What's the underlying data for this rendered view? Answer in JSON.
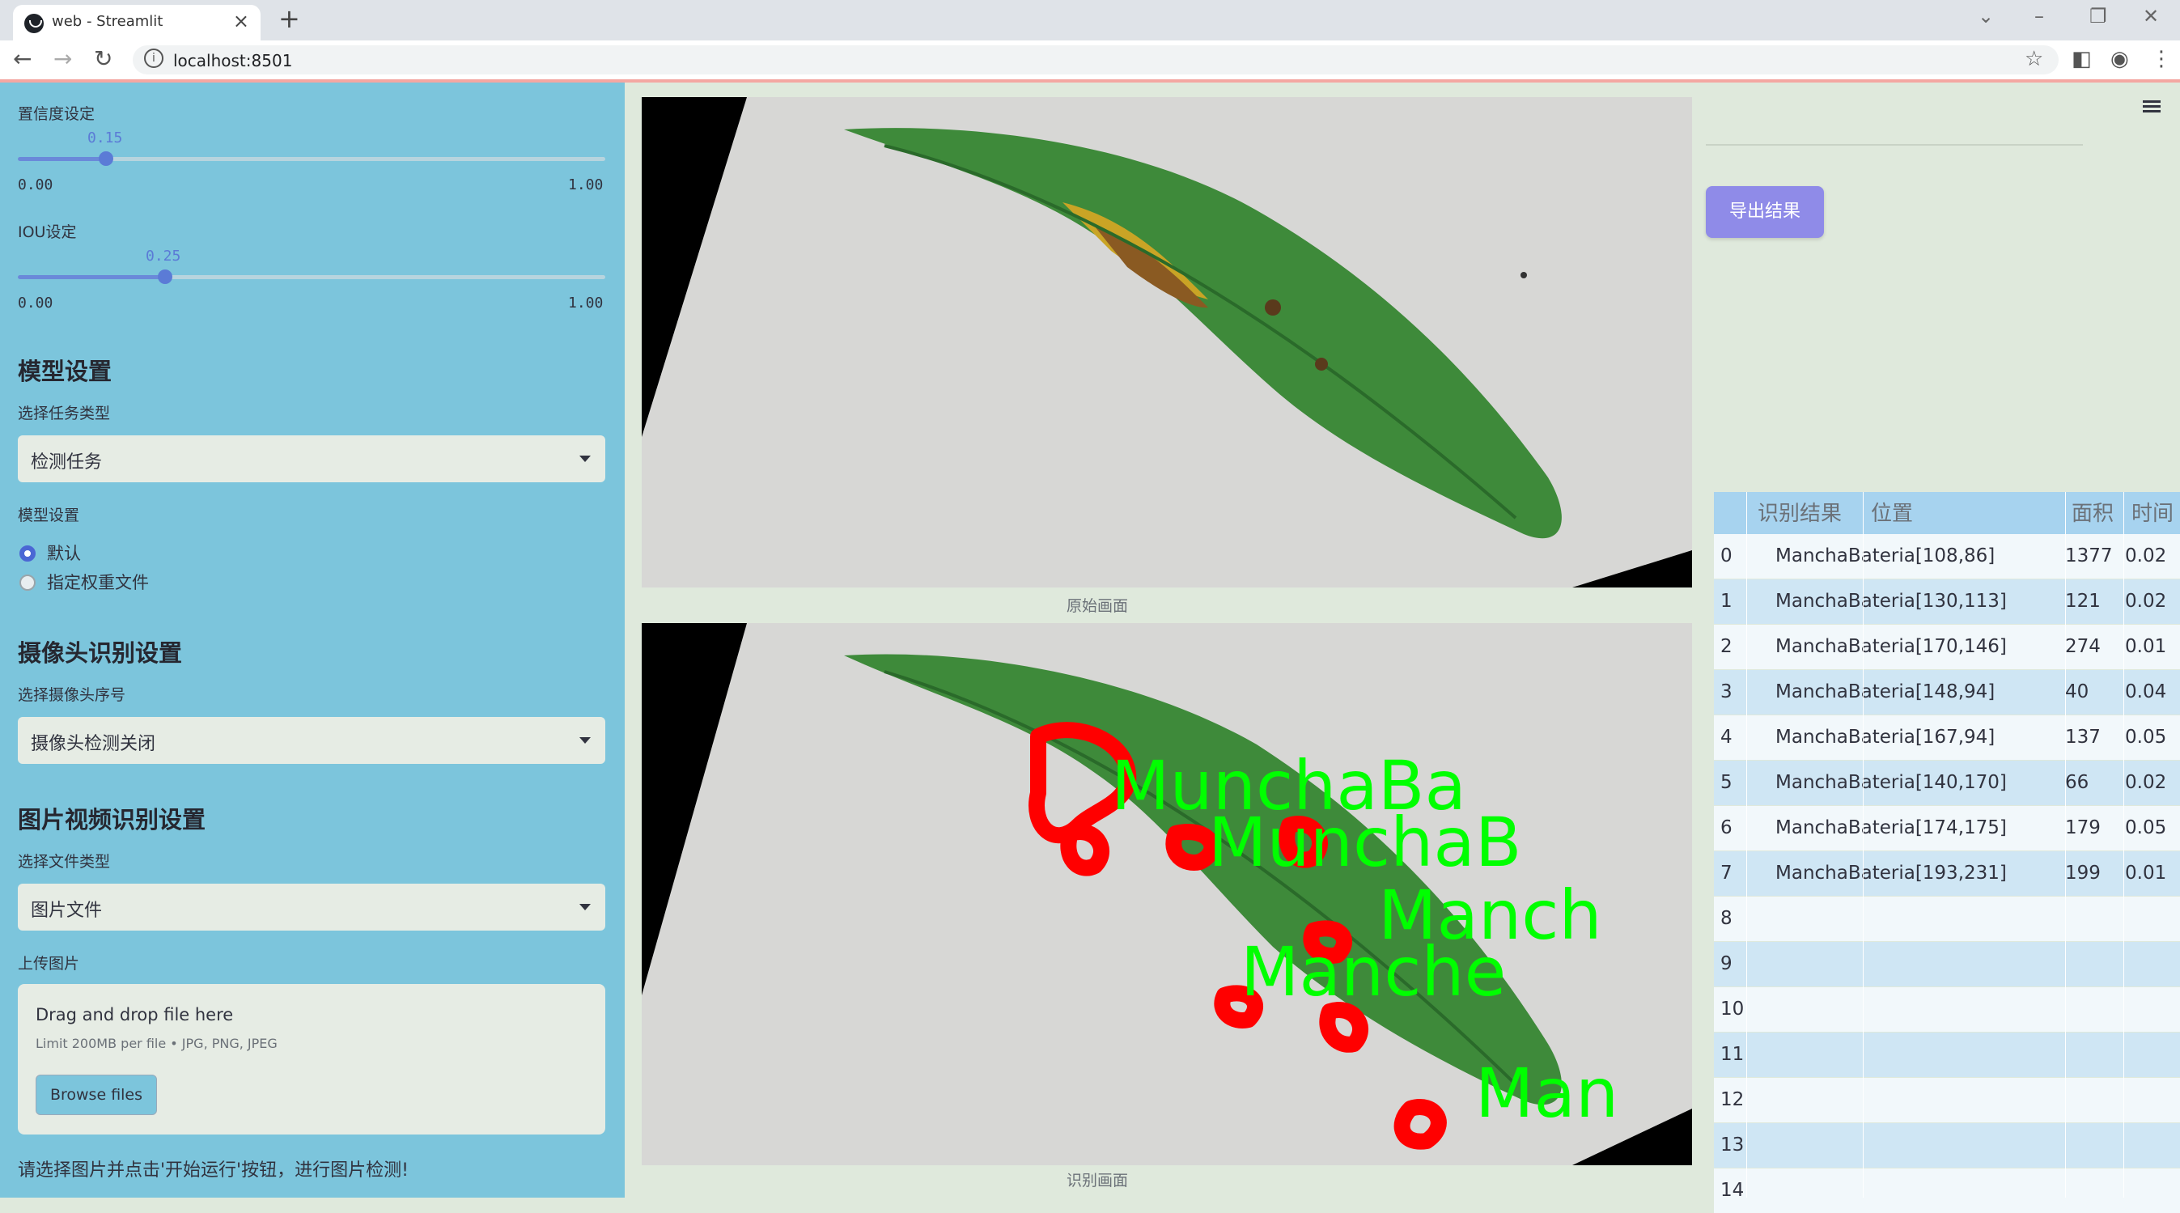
{
  "browser": {
    "tab_title": "web - Streamlit",
    "tab_close": "×",
    "new_tab": "+",
    "url": "localhost:8501"
  },
  "sidebar": {
    "confidence": {
      "label": "置信度设定",
      "value": "0.15",
      "value_fraction": 0.15,
      "min": "0.00",
      "max": "1.00"
    },
    "iou": {
      "label": "IOU设定",
      "value": "0.25",
      "value_fraction": 0.25,
      "min": "0.00",
      "max": "1.00"
    },
    "model_section": "模型设置",
    "task_type_label": "选择任务类型",
    "task_type_value": "检测任务",
    "model_setting_label": "模型设置",
    "model_options": [
      "默认",
      "指定权重文件"
    ],
    "model_selected": "默认",
    "camera_section": "摄像头识别设置",
    "camera_label": "选择摄像头序号",
    "camera_value": "摄像头检测关闭",
    "media_section": "图片视频识别设置",
    "file_type_label": "选择文件类型",
    "file_type_value": "图片文件",
    "upload_label": "上传图片",
    "dropzone_title": "Drag and drop file here",
    "dropzone_limit": "Limit 200MB per file • JPG, PNG, JPEG",
    "browse_button": "Browse files",
    "hint": "请选择图片并点击'开始运行'按钮，进行图片检测!"
  },
  "main": {
    "original_caption": "原始画面",
    "detected_caption": "识别画面",
    "detection_labels": [
      "MunchaBa",
      "MunchaB",
      "Manch",
      "Manche",
      "Man"
    ]
  },
  "panel": {
    "export_button": "导出结果",
    "table_headers": [
      "",
      "识别结果",
      "位置",
      "面积",
      "时间"
    ],
    "rows": [
      [
        "0",
        "ManchaBateria[108,86]",
        "",
        "1377",
        "0.02"
      ],
      [
        "1",
        "ManchaBateria[130,113]",
        "",
        "121",
        "0.02"
      ],
      [
        "2",
        "ManchaBateria[170,146]",
        "",
        "274",
        "0.01"
      ],
      [
        "3",
        "ManchaBateria[148,94]",
        "",
        "40",
        "0.04"
      ],
      [
        "4",
        "ManchaBateria[167,94]",
        "",
        "137",
        "0.05"
      ],
      [
        "5",
        "ManchaBateria[140,170]",
        "",
        "66",
        "0.02"
      ],
      [
        "6",
        "ManchaBateria[174,175]",
        "",
        "179",
        "0.05"
      ],
      [
        "7",
        "ManchaBateria[193,231]",
        "",
        "199",
        "0.01"
      ],
      [
        "8",
        "",
        "",
        "",
        ""
      ],
      [
        "9",
        "",
        "",
        "",
        ""
      ],
      [
        "10",
        "",
        "",
        "",
        ""
      ],
      [
        "11",
        "",
        "",
        "",
        ""
      ],
      [
        "12",
        "",
        "",
        "",
        ""
      ],
      [
        "13",
        "",
        "",
        "",
        ""
      ],
      [
        "14",
        "",
        "",
        "",
        ""
      ]
    ]
  },
  "colors": {
    "sidebar_bg": "#7cc5dc",
    "main_bg": "#dfe9dc",
    "accent": "#5b7bd6",
    "export_button": "#8f8be8",
    "row_even": "#f2f8fb",
    "row_odd": "#cfe6f4",
    "detection_box": "#ff0000",
    "detection_text": "#00ff00"
  }
}
